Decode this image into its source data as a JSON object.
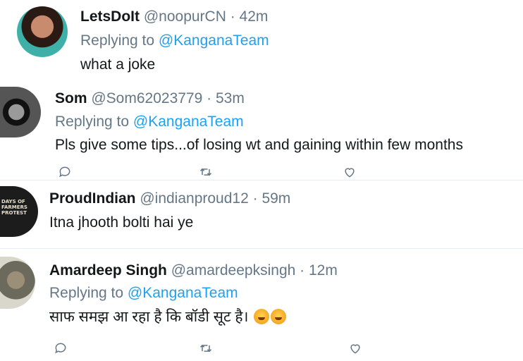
{
  "tweets": [
    {
      "name": "LetsDoIt",
      "handle": "@noopurCN",
      "time": "· 42m",
      "replying_prefix": "Replying to",
      "replying_to": "@KanganaTeam",
      "text": "what a joke"
    },
    {
      "name": "Som",
      "handle": "@Som62023779",
      "time": "· 53m",
      "replying_prefix": "Replying to",
      "replying_to": "@KanganaTeam",
      "text": "Pls give some tips...of losing wt and gaining within few months"
    },
    {
      "name": "ProudIndian",
      "handle": "@indianproud12",
      "time": "· 59m",
      "text": "Itna jhooth bolti hai ye",
      "avatar_text": "DAYS OF FARMERS PROTEST"
    },
    {
      "name": "Amardeep Singh",
      "handle": "@amardeepksingh",
      "time": "· 12m",
      "replying_prefix": "Replying to",
      "replying_to": "@KanganaTeam",
      "text": "साफ समझ आ रहा है कि बॉडी सूट है।"
    }
  ],
  "colors": {
    "accent": "#1da1f2",
    "secondary_text": "#657786",
    "primary_text": "#14171a"
  },
  "icons": [
    "reply-icon",
    "retweet-icon",
    "like-icon"
  ]
}
